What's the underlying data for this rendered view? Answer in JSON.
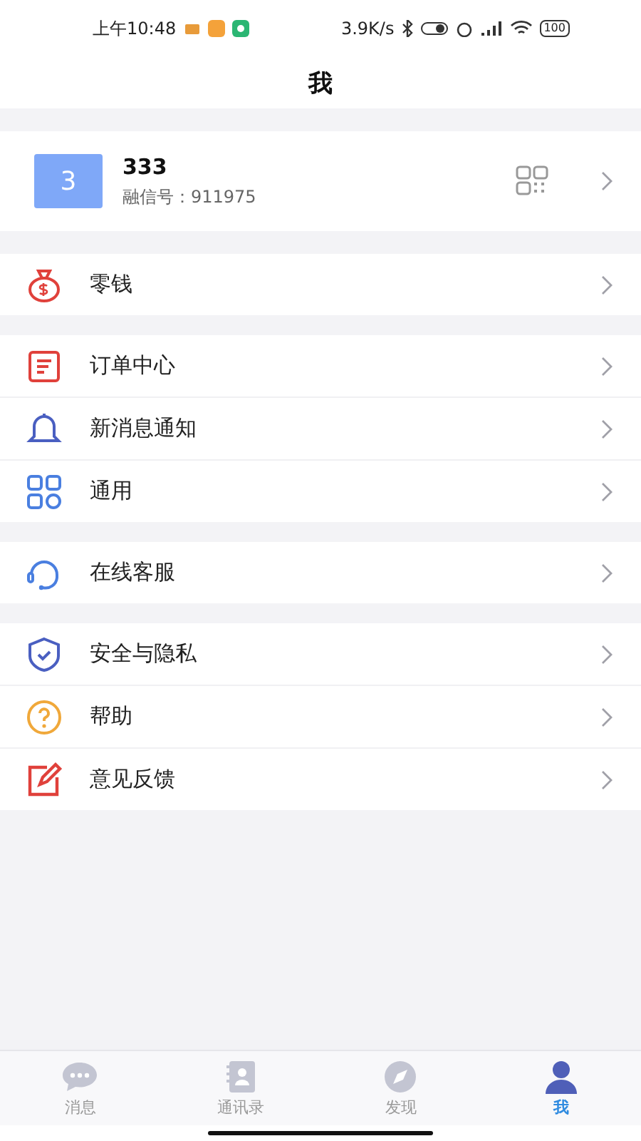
{
  "status_bar": {
    "time": "上午10:48",
    "speed": "3.9K/s",
    "battery": "100"
  },
  "header": {
    "title": "我"
  },
  "profile": {
    "avatar": "3",
    "name": "333",
    "id_label": "融信号：911975"
  },
  "groups": [
    {
      "items": [
        {
          "kind": "wallet",
          "label": "零钱"
        }
      ]
    },
    {
      "items": [
        {
          "kind": "orders",
          "label": "订单中心"
        },
        {
          "kind": "bell",
          "label": "新消息通知"
        },
        {
          "kind": "grid",
          "label": "通用"
        }
      ]
    },
    {
      "items": [
        {
          "kind": "headset",
          "label": "在线客服"
        }
      ]
    },
    {
      "items": [
        {
          "kind": "shield",
          "label": "安全与隐私"
        },
        {
          "kind": "help",
          "label": "帮助"
        },
        {
          "kind": "feedback",
          "label": "意见反馈"
        }
      ]
    }
  ],
  "tabs": [
    {
      "kind": "chat",
      "label": "消息",
      "selected": false
    },
    {
      "kind": "contacts",
      "label": "通讯录",
      "selected": false
    },
    {
      "kind": "compass",
      "label": "发现",
      "selected": false
    },
    {
      "kind": "person",
      "label": "我",
      "selected": true
    }
  ]
}
